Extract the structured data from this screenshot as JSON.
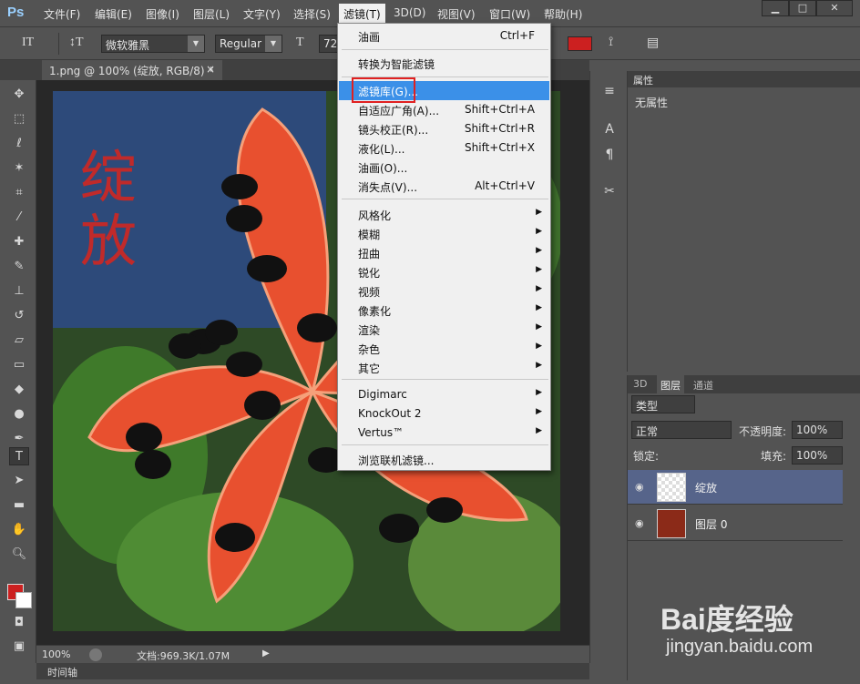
{
  "menubar": {
    "logo": "Ps",
    "items": [
      "文件(F)",
      "编辑(E)",
      "图像(I)",
      "图层(L)",
      "文字(Y)",
      "选择(S)",
      "滤镜(T)",
      "3D(D)",
      "视图(V)",
      "窗口(W)",
      "帮助(H)"
    ],
    "active_index": 6,
    "window_buttons": [
      "▁",
      "□",
      "✕"
    ]
  },
  "options": {
    "tool_glyph": "IT",
    "orient_glyph": "↕T",
    "font_family": "微软雅黑",
    "font_style": "Regular",
    "size_glyph": "T",
    "font_size": "72"
  },
  "document": {
    "tab_label": "1.png @ 100% (绽放, RGB/8) *",
    "canvas_text": "绽放"
  },
  "status": {
    "zoom": "100%",
    "doc_info": "文档:969.3K/1.07M",
    "timeline": "时间轴"
  },
  "filter_menu": {
    "items": [
      {
        "label": "油画",
        "shortcut": "Ctrl+F"
      },
      {
        "label": "转换为智能滤镜"
      },
      {
        "label": "滤镜库(G)...",
        "highlighted": true
      },
      {
        "label": "自适应广角(A)...",
        "shortcut": "Shift+Ctrl+A"
      },
      {
        "label": "镜头校正(R)...",
        "shortcut": "Shift+Ctrl+R"
      },
      {
        "label": "液化(L)...",
        "shortcut": "Shift+Ctrl+X"
      },
      {
        "label": "油画(O)..."
      },
      {
        "label": "消失点(V)...",
        "shortcut": "Alt+Ctrl+V"
      },
      {
        "label": "风格化",
        "submenu": true
      },
      {
        "label": "模糊",
        "submenu": true
      },
      {
        "label": "扭曲",
        "submenu": true
      },
      {
        "label": "锐化",
        "submenu": true
      },
      {
        "label": "视频",
        "submenu": true
      },
      {
        "label": "像素化",
        "submenu": true
      },
      {
        "label": "渲染",
        "submenu": true
      },
      {
        "label": "杂色",
        "submenu": true
      },
      {
        "label": "其它",
        "submenu": true
      },
      {
        "label": "Digimarc",
        "submenu": true
      },
      {
        "label": "KnockOut 2",
        "submenu": true
      },
      {
        "label": "Vertus™",
        "submenu": true
      },
      {
        "label": "浏览联机滤镜..."
      }
    ]
  },
  "properties_panel": {
    "title": "属性",
    "body": "无属性"
  },
  "layers_panel": {
    "tabs": [
      "3D",
      "图层",
      "通道"
    ],
    "active_tab": 1,
    "filter_kind": "类型",
    "blend_mode": "正常",
    "opacity_label": "不透明度:",
    "opacity": "100%",
    "lock_label": "锁定:",
    "fill_label": "填充:",
    "fill": "100%",
    "layers": [
      {
        "name": "绽放",
        "selected": true,
        "type": "text"
      },
      {
        "name": "图层 0",
        "selected": false,
        "type": "image"
      }
    ]
  },
  "watermark": {
    "logo": "Bai度经验",
    "url": "jingyan.baidu.com"
  },
  "colors": {
    "foreground": "#cc2020",
    "background": "#ffffff",
    "highlight": "#3b90e8",
    "annotation_box": "#e02020"
  }
}
